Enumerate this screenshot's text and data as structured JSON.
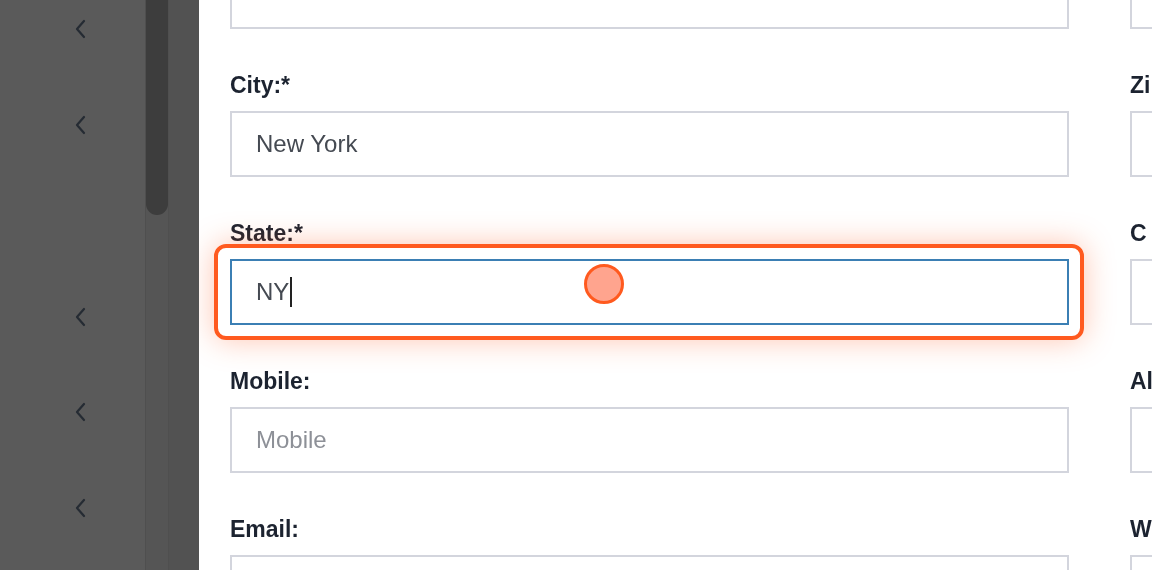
{
  "left_column": [
    {
      "kind": "cut_field",
      "focused": false,
      "highlighted": false
    },
    {
      "kind": "field",
      "label": "City:*",
      "value": "New York",
      "focused": false,
      "highlighted": false
    },
    {
      "kind": "field",
      "label": "State:*",
      "value": "NY",
      "focused": true,
      "highlighted": true
    },
    {
      "kind": "field",
      "label": "Mobile:",
      "placeholder": "Mobile",
      "focused": false,
      "highlighted": false
    },
    {
      "kind": "field",
      "label": "Email:",
      "focused": false,
      "highlighted": false
    }
  ],
  "right_column": [
    {
      "kind": "cut_field"
    },
    {
      "kind": "field",
      "label": "Zi"
    },
    {
      "kind": "field",
      "label": "C"
    },
    {
      "kind": "field",
      "label": "Al"
    },
    {
      "kind": "field",
      "label": "W"
    }
  ]
}
